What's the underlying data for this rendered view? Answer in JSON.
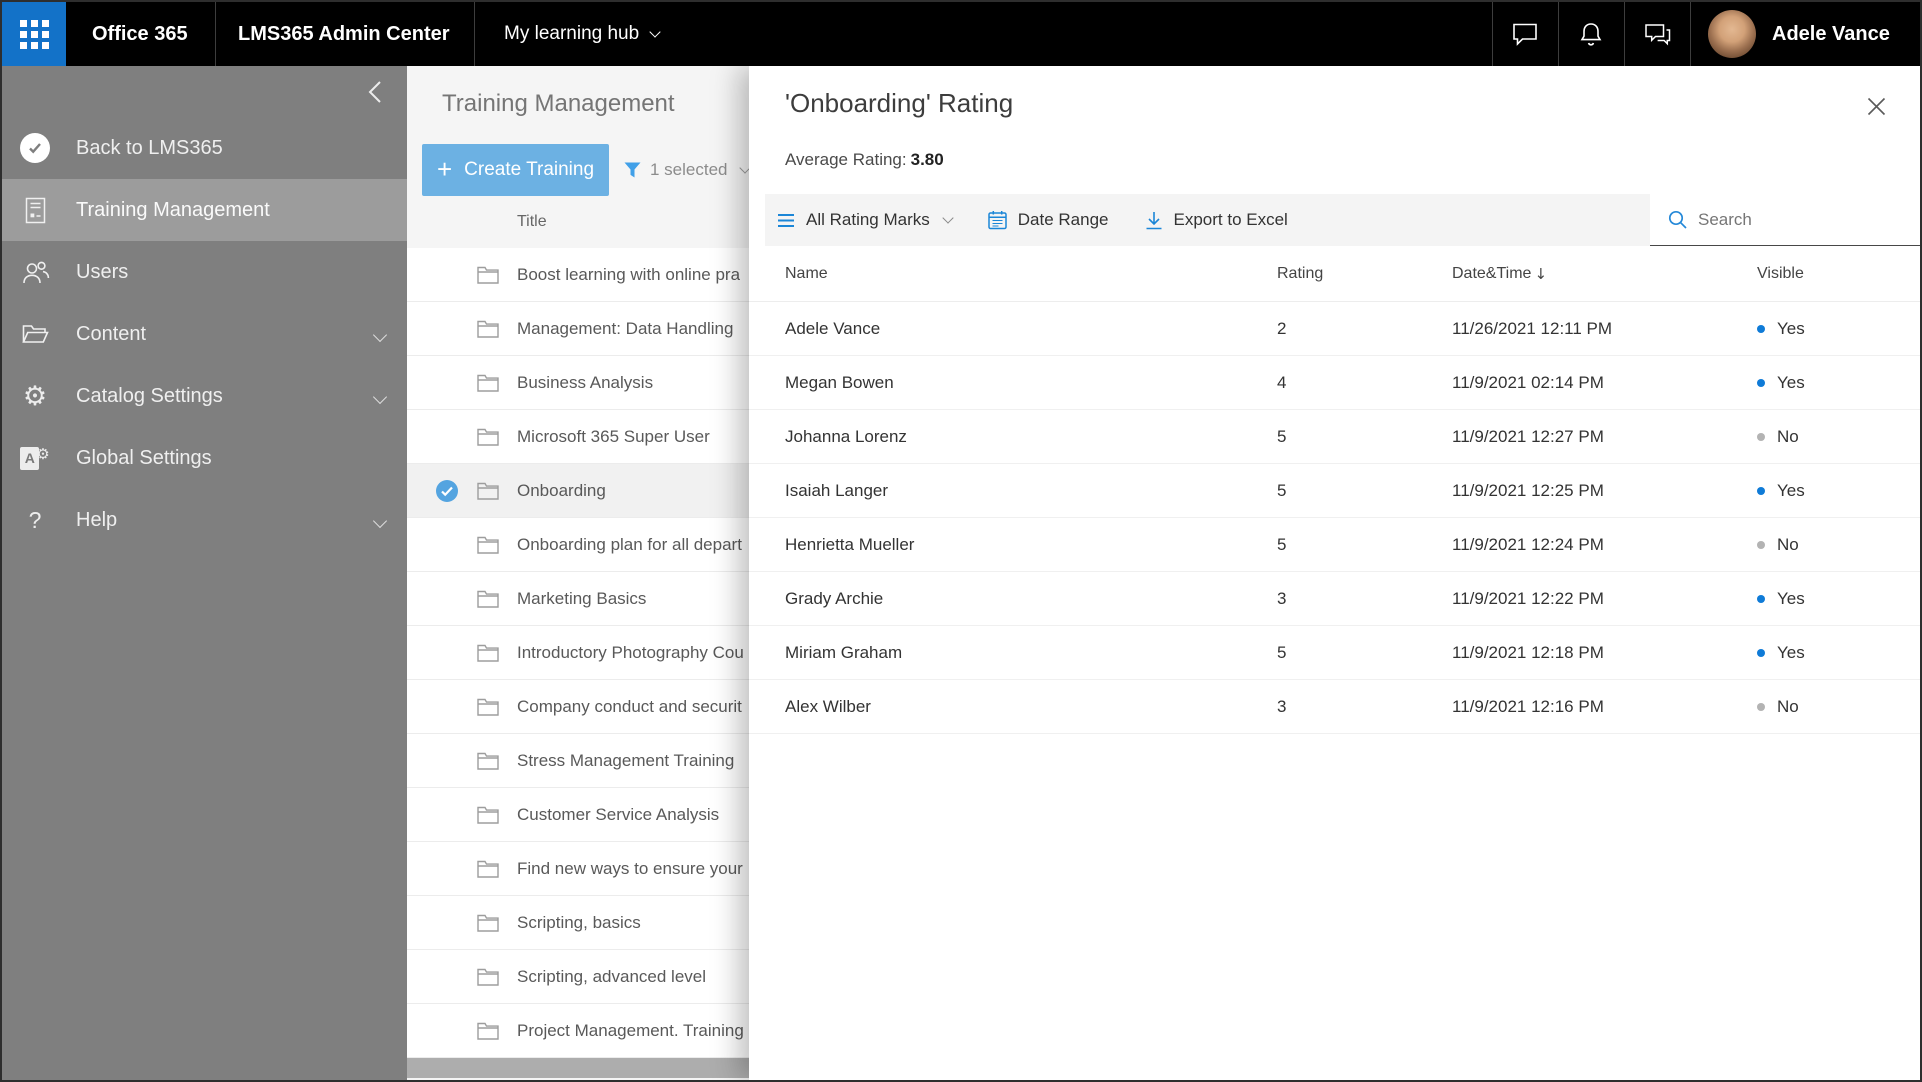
{
  "topbar": {
    "office_label": "Office 365",
    "admin_center_label": "LMS365 Admin Center",
    "hub_label": "My learning hub",
    "user_name": "Adele Vance",
    "icons": [
      "app-launcher-waffle",
      "chat-bubble",
      "bell",
      "feedback-bubbles"
    ]
  },
  "sidebar": {
    "items": [
      {
        "label": "Back to LMS365",
        "icon": "check-circle"
      },
      {
        "label": "Training Management",
        "icon": "document-list",
        "selected": true
      },
      {
        "label": "Users",
        "icon": "people"
      },
      {
        "label": "Content",
        "icon": "folder-open",
        "expandable": true
      },
      {
        "label": "Catalog Settings",
        "icon": "gear",
        "expandable": true
      },
      {
        "label": "Global Settings",
        "icon": "a-page-gear"
      },
      {
        "label": "Help",
        "icon": "question-mark",
        "expandable": true
      }
    ]
  },
  "training_panel": {
    "title": "Training Management",
    "create_button": "Create Training",
    "filter_label": "1 selected",
    "column_title": "Title",
    "rows": [
      {
        "title": "Boost learning with online pra",
        "selected": false
      },
      {
        "title": "Management: Data Handling",
        "selected": false
      },
      {
        "title": "Business Analysis",
        "selected": false
      },
      {
        "title": "Microsoft 365 Super User",
        "selected": false
      },
      {
        "title": "Onboarding",
        "selected": true
      },
      {
        "title": "Onboarding plan for all depart",
        "selected": false
      },
      {
        "title": "Marketing Basics",
        "selected": false
      },
      {
        "title": "Introductory Photography Cou",
        "selected": false
      },
      {
        "title": "Company conduct and securit",
        "selected": false
      },
      {
        "title": "Stress Management Training",
        "selected": false
      },
      {
        "title": "Customer Service Analysis",
        "selected": false
      },
      {
        "title": "Find new ways to ensure your",
        "selected": false
      },
      {
        "title": "Scripting, basics",
        "selected": false
      },
      {
        "title": "Scripting, advanced level",
        "selected": false
      },
      {
        "title": "Project Management. Training",
        "selected": false
      }
    ]
  },
  "modal": {
    "title": "'Onboarding' Rating",
    "average_label": "Average Rating:",
    "average_value": "3.80",
    "toolbar": {
      "filter": "All Rating Marks",
      "date_range": "Date Range",
      "export": "Export to Excel",
      "search_placeholder": "Search"
    },
    "table": {
      "columns": [
        "Name",
        "Rating",
        "Date&Time",
        "Visible"
      ],
      "sort_column": "Date&Time",
      "sort_direction": "descending",
      "rows": [
        {
          "name": "Adele Vance",
          "rating": 2,
          "datetime": "11/26/2021 12:11 PM",
          "visible": "Yes",
          "visible_yes": true
        },
        {
          "name": "Megan Bowen",
          "rating": 4,
          "datetime": "11/9/2021 02:14 PM",
          "visible": "Yes",
          "visible_yes": true
        },
        {
          "name": "Johanna Lorenz",
          "rating": 5,
          "datetime": "11/9/2021 12:27 PM",
          "visible": "No",
          "visible_yes": false
        },
        {
          "name": "Isaiah Langer",
          "rating": 5,
          "datetime": "11/9/2021 12:25 PM",
          "visible": "Yes",
          "visible_yes": true
        },
        {
          "name": "Henrietta Mueller",
          "rating": 5,
          "datetime": "11/9/2021 12:24 PM",
          "visible": "No",
          "visible_yes": false
        },
        {
          "name": "Grady Archie",
          "rating": 3,
          "datetime": "11/9/2021 12:22 PM",
          "visible": "Yes",
          "visible_yes": true
        },
        {
          "name": "Miriam Graham",
          "rating": 5,
          "datetime": "11/9/2021 12:18 PM",
          "visible": "Yes",
          "visible_yes": true
        },
        {
          "name": "Alex Wilber",
          "rating": 3,
          "datetime": "11/9/2021 12:16 PM",
          "visible": "No",
          "visible_yes": false
        }
      ]
    }
  },
  "colors": {
    "topbar_bg": "#000000",
    "app_launcher_blue": "#1372c8",
    "sidebar_gray": "#7f7f7f",
    "sidebar_selected_gray": "#9c9c9c",
    "panel_bg": "#f5f5f5",
    "create_button_blue": "#6cb1e3",
    "toolbar_icon_blue": "#1b86d7",
    "selected_check_blue": "#54a4e0",
    "visible_yes_dot": "#0f7bd7",
    "visible_no_dot": "#b3b3b3"
  }
}
